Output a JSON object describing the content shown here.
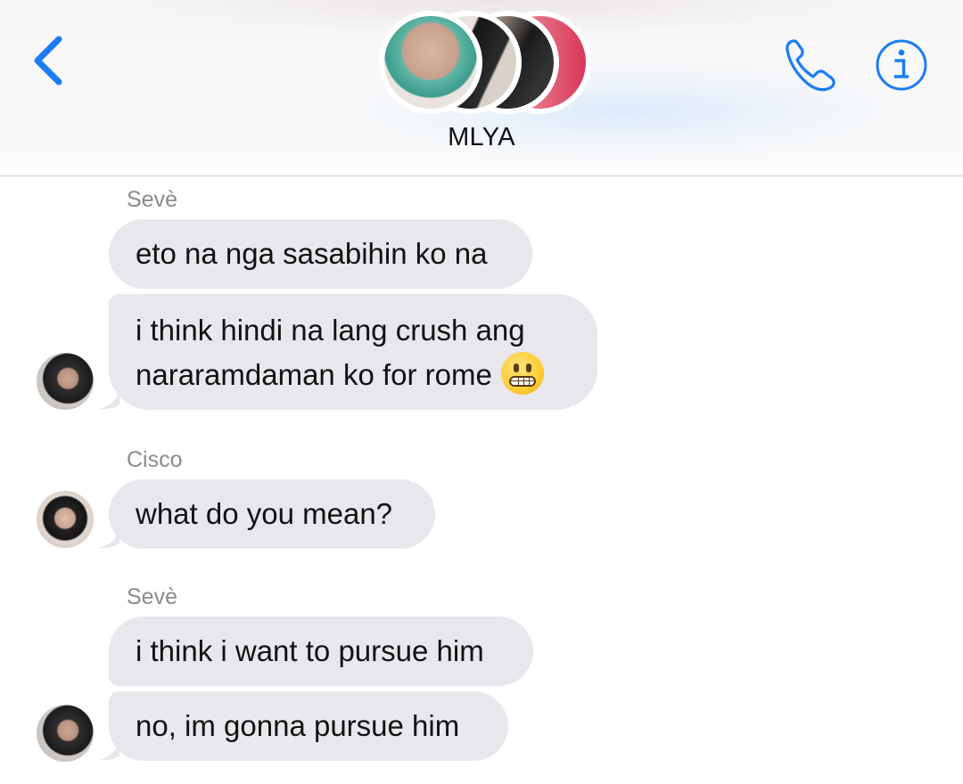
{
  "header": {
    "title": "MLYA",
    "back_icon": "chevron-left-icon",
    "call_icon": "phone-icon",
    "info_icon": "info-icon",
    "accent_color": "#1b7cf5"
  },
  "messages": [
    {
      "sender": "Sevè",
      "lines": [
        "eto na nga sasabihin ko na"
      ]
    },
    {
      "lines": [
        "i think hindi na lang crush ang",
        "nararamdaman ko for rome"
      ],
      "emoji": "grimacing-face-icon"
    },
    {
      "sender": "Cisco",
      "lines": [
        "what do you mean?"
      ]
    },
    {
      "sender": "Sevè",
      "lines": [
        "i think i want to pursue him"
      ]
    },
    {
      "lines": [
        "no, im gonna pursue him"
      ]
    }
  ],
  "colors": {
    "bubble_background": "#e7e7ec",
    "sender_name": "#8a8a8e"
  }
}
